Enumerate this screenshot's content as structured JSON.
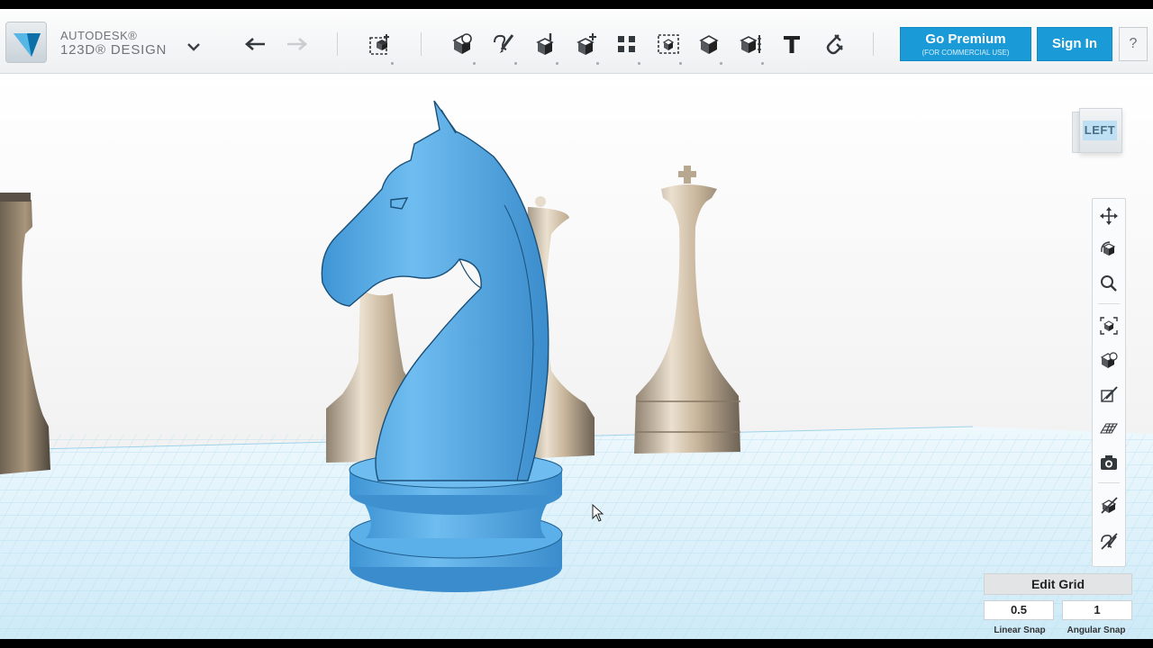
{
  "app": {
    "brand_line1": "AUTODESK®",
    "brand_line2": "123D® DESIGN"
  },
  "toolbar": {
    "items": [
      {
        "name": "undo-icon"
      },
      {
        "name": "redo-icon"
      },
      {
        "name": "transform-icon"
      },
      {
        "name": "primitives-icon"
      },
      {
        "name": "sketch-icon"
      },
      {
        "name": "construct-icon"
      },
      {
        "name": "modify-icon"
      },
      {
        "name": "pattern-icon"
      },
      {
        "name": "grouping-icon"
      },
      {
        "name": "combine-icon"
      },
      {
        "name": "measure-icon"
      },
      {
        "name": "text-icon"
      },
      {
        "name": "snap-icon"
      }
    ],
    "premium_label": "Go Premium",
    "premium_sublabel": "(FOR COMMERCIAL USE)",
    "signin_label": "Sign In",
    "help_label": "?"
  },
  "viewcube": {
    "face_label": "LEFT"
  },
  "nav": {
    "items": [
      "pan-icon",
      "orbit-icon",
      "zoom-icon",
      "fit-icon",
      "view-mode-icon",
      "materials-icon",
      "grid-toggle-icon",
      "screenshot-icon",
      "show-hide-icon",
      "hide-sketch-icon"
    ]
  },
  "edit_grid": {
    "title": "Edit Grid",
    "linear_snap_value": "0.5",
    "angular_snap_value": "1",
    "linear_snap_label": "Linear Snap",
    "angular_snap_label": "Angular Snap"
  },
  "colors": {
    "accent": "#1a9ad6",
    "model_blue": "#5aaee6",
    "grid_blue": "#bfe3f3",
    "chess_piece": "#c8b9a4"
  }
}
